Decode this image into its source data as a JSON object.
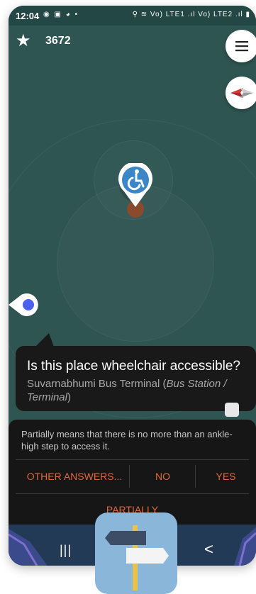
{
  "status_bar": {
    "time": "12:04",
    "notification_icons": "◉ ▣ ◕ •",
    "system_icons": "⚲ ≋ Vo) LTE1 .ıl Vo) LTE2 .ıl ▮"
  },
  "score": {
    "value": "3672"
  },
  "question": {
    "title": "Is this place wheelchair accessible?",
    "place_name": "Suvarnabhumi Bus Terminal",
    "place_type_open": "(",
    "place_type": "Bus Station / Terminal",
    "place_type_close": ")"
  },
  "hint": "Partially means that there is no more than an ankle-high step to access it.",
  "answers": {
    "other": "OTHER ANSWERS...",
    "no": "NO",
    "yes": "YES",
    "partially": "PARTIALLY"
  },
  "nav": {
    "recent": "|||",
    "back": "<"
  },
  "colors": {
    "map": "#2f5552",
    "accent": "#e2673c",
    "pin": "#3a86c8",
    "panel": "#161616"
  },
  "icons": [
    "star-icon",
    "menu-icon",
    "compass-icon",
    "wheelchair-icon",
    "location-icon",
    "signpost-icon"
  ]
}
